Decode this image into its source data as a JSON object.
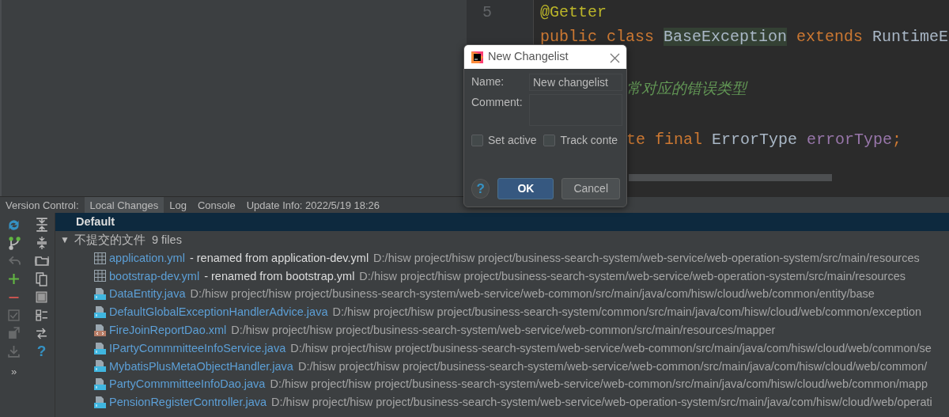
{
  "editor": {
    "lines": [
      {
        "kind": "full",
        "number": "5",
        "tokens": [
          {
            "text": "@Getter",
            "kind": "annotation"
          }
        ]
      },
      {
        "kind": "full",
        "tokens": [
          {
            "text": "public class ",
            "kind": "keyword"
          },
          {
            "text": "BaseException",
            "kind": "plain",
            "highlighted": true
          },
          {
            "text": " extends ",
            "kind": "keyword"
          },
          {
            "text": "RuntimeE",
            "kind": "plain"
          }
        ]
      },
      {
        "kind": "blank"
      },
      {
        "kind": "partial",
        "tokens": [
          {
            "text": "常对应的错误类型",
            "kind": "comment"
          }
        ]
      },
      {
        "kind": "blank"
      },
      {
        "kind": "partial",
        "tokens": [
          {
            "text": "te final ",
            "kind": "keyword"
          },
          {
            "text": "ErrorType ",
            "kind": "plain"
          },
          {
            "text": "errorType",
            "kind": "field"
          },
          {
            "text": ";",
            "kind": "keyword"
          }
        ]
      }
    ]
  },
  "tool_window": {
    "label": "Version Control:",
    "tabs": [
      {
        "label": "Local Changes",
        "selected": true
      },
      {
        "label": "Log",
        "selected": false
      },
      {
        "label": "Console",
        "selected": false
      },
      {
        "label": "Update Info: 2022/5/19 18:26",
        "selected": false
      }
    ]
  },
  "toolbar": {
    "buttons": [
      {
        "disabled": false
      },
      {
        "disabled": false
      },
      {
        "disabled": false
      },
      {
        "disabled": false
      },
      {
        "disabled": true
      },
      {
        "disabled": false
      },
      {
        "disabled": false
      },
      {
        "disabled": false
      },
      {
        "disabled": false
      },
      {
        "disabled": false
      },
      {
        "disabled": true
      },
      {
        "disabled": false
      },
      {
        "disabled": true
      },
      {
        "disabled": false
      },
      {
        "disabled": true
      },
      {
        "disabled": false,
        "label": "?"
      }
    ],
    "more": "»"
  },
  "changes": {
    "changelist": {
      "name": "Default",
      "selected": true
    },
    "group": {
      "toggle": "▼",
      "name": "不提交的文件",
      "count": "9 files",
      "files": [
        {
          "kind": "yml",
          "name": "application.yml",
          "note": "- renamed from application-dev.yml",
          "path": "D:/hisw project/hisw project/business-search-system/web-service/web-operation-system/src/main/resources"
        },
        {
          "kind": "yml",
          "name": "bootstrap-dev.yml",
          "note": "- renamed from bootstrap.yml",
          "path": "D:/hisw project/hisw project/business-search-system/web-service/web-operation-system/src/main/resources"
        },
        {
          "kind": "java",
          "name": "DataEntity.java",
          "path": "D:/hisw project/hisw project/business-search-system/web-service/web-common/src/main/java/com/hisw/cloud/web/common/entity/base"
        },
        {
          "kind": "java",
          "name": "DefaultGlobalExceptionHandlerAdvice.java",
          "path": "D:/hisw project/hisw project/business-search-system/common/src/main/java/com/hisw/cloud/web/common/exception"
        },
        {
          "kind": "xml",
          "name": "FireJoinReportDao.xml",
          "path": "D:/hisw project/hisw project/business-search-system/web-service/web-common/src/main/resources/mapper"
        },
        {
          "kind": "java",
          "name": "IPartyCommmitteeInfoService.java",
          "path": "D:/hisw project/hisw project/business-search-system/web-service/web-common/src/main/java/com/hisw/cloud/web/common/se"
        },
        {
          "kind": "java",
          "name": "MybatisPlusMetaObjectHandler.java",
          "path": "D:/hisw project/hisw project/business-search-system/web-service/web-common/src/main/java/com/hisw/cloud/web/common/"
        },
        {
          "kind": "java",
          "name": "PartyCommmitteeInfoDao.java",
          "path": "D:/hisw project/hisw project/business-search-system/web-service/web-common/src/main/java/com/hisw/cloud/web/common/mapp"
        },
        {
          "kind": "java",
          "name": "PensionRegisterController.java",
          "path": "D:/hisw project/hisw project/business-search-system/web-service/web-operation-system/src/main/java/com/hisw/cloud/web/operati"
        }
      ]
    }
  },
  "dialog": {
    "title": "New Changelist",
    "name_label": "Name:",
    "name_value": "New changelist",
    "comment_label": "Comment:",
    "checkboxes": [
      {
        "label": "Set active",
        "checked": false
      },
      {
        "label": "Track conte",
        "checked": false
      }
    ],
    "help": "?",
    "buttons": [
      {
        "label": "OK",
        "default": true
      },
      {
        "label": "Cancel",
        "default": false
      }
    ]
  }
}
